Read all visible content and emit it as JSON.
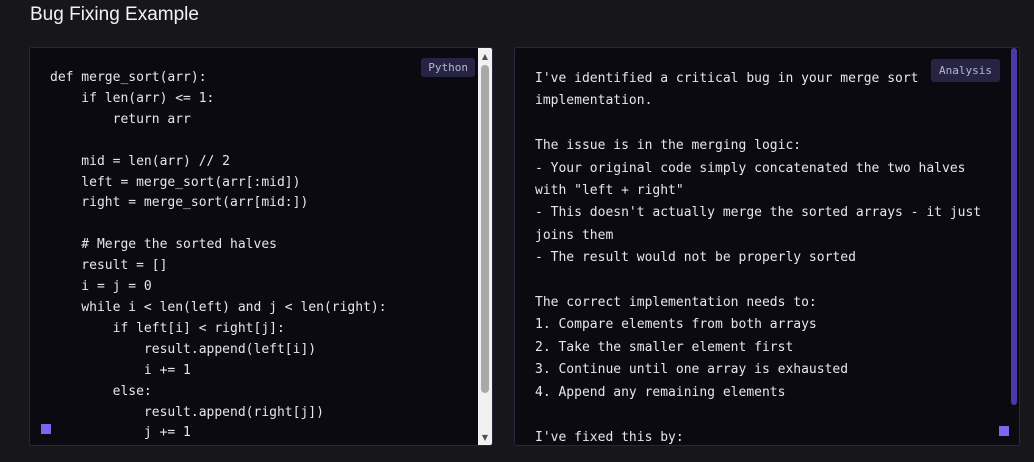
{
  "header": {
    "title": "Bug Fixing Example"
  },
  "code_panel": {
    "language_badge": "Python",
    "code": "def merge_sort(arr):\n    if len(arr) <= 1:\n        return arr\n\n    mid = len(arr) // 2\n    left = merge_sort(arr[:mid])\n    right = merge_sort(arr[mid:])\n\n    # Merge the sorted halves\n    result = []\n    i = j = 0\n    while i < len(left) and j < len(right):\n        if left[i] < right[j]:\n            result.append(left[i])\n            i += 1\n        else:\n            result.append(right[j])\n            j += 1"
  },
  "analysis_panel": {
    "badge": "Analysis",
    "text": "I've identified a critical bug in your merge sort\nimplementation.\n\nThe issue is in the merging logic:\n- Your original code simply concatenated the two halves\nwith \"left + right\"\n- This doesn't actually merge the sorted arrays - it just\njoins them\n- The result would not be properly sorted\n\nThe correct implementation needs to:\n1. Compare elements from both arrays\n2. Take the smaller element first\n3. Continue until one array is exhausted\n4. Append any remaining elements\n\nI've fixed this by:"
  },
  "colors": {
    "background": "#16161b",
    "panel": "#0b0a10",
    "accent": "#7b66f0",
    "badge": "#272343"
  }
}
